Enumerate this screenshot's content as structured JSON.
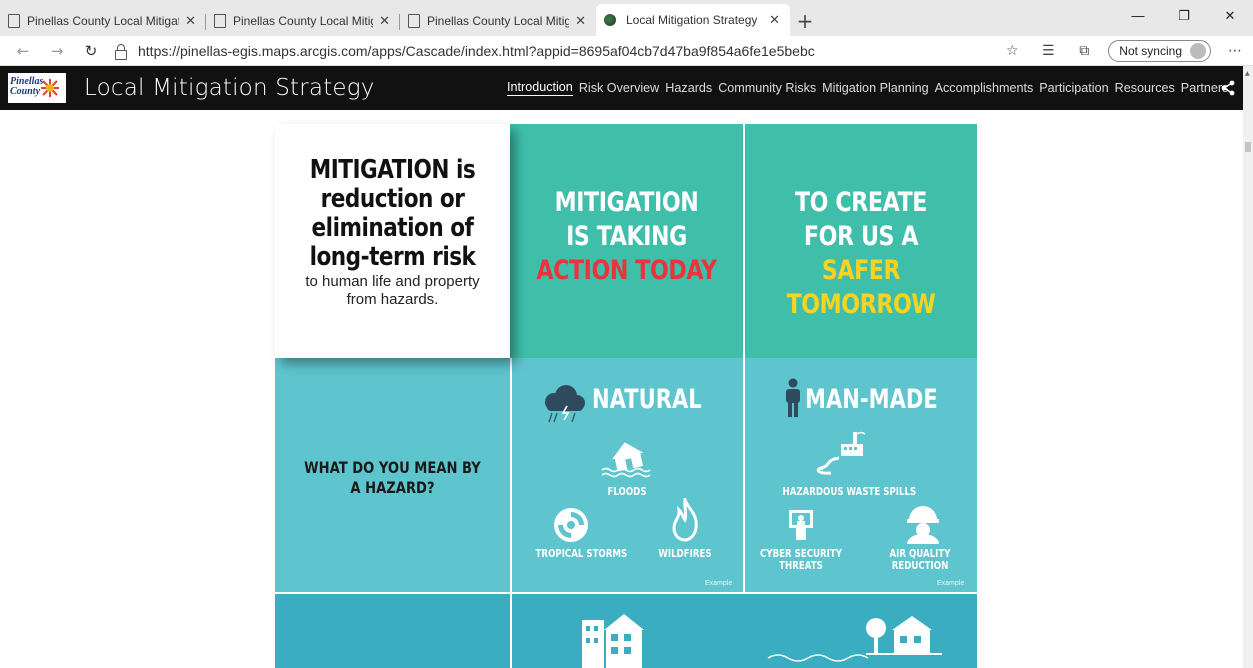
{
  "browser": {
    "tabs": [
      {
        "label": "Pinellas County Local Mitigation"
      },
      {
        "label": "Pinellas County Local Mitigation"
      },
      {
        "label": "Pinellas County Local Mitigation"
      },
      {
        "label": "Local Mitigation Strategy",
        "active": true
      }
    ],
    "url": "https://pinellas-egis.maps.arcgis.com/apps/Cascade/index.html?appid=8695af04cb7d47ba9f854a6fe1e5bebc",
    "sync_label": "Not syncing"
  },
  "app": {
    "logo_text_line1": "Pinellas",
    "logo_text_line2": "County",
    "title": "Local Mitigation Strategy",
    "nav": [
      "Introduction",
      "Risk Overview",
      "Hazards",
      "Community Risks",
      "Mitigation Planning",
      "Accomplishments",
      "Participation",
      "Resources",
      "Partners"
    ]
  },
  "infographic": {
    "definition": {
      "line1": "MITIGATION is",
      "line2": "reduction or",
      "line3": "elimination of",
      "line4": "long-term risk",
      "small1": "to human life and property",
      "small2": "from hazards."
    },
    "panel_action": {
      "line1": "MITIGATION",
      "line2": "IS TAKING",
      "line3": "ACTION TODAY"
    },
    "panel_safer": {
      "line1": "TO CREATE",
      "line2": "FOR US A",
      "line3": "SAFER TOMORROW"
    },
    "hazard_question": {
      "line1": "WHAT DO YOU MEAN BY",
      "line2": "A HAZARD?"
    },
    "natural": {
      "title": "NATURAL",
      "items": [
        "FLOODS",
        "TROPICAL STORMS",
        "WILDFIRES"
      ],
      "example": "Example"
    },
    "manmade": {
      "title": "MAN-MADE",
      "items": [
        "HAZARDOUS WASTE SPILLS",
        "CYBER SECURITY",
        "THREATS",
        "AIR QUALITY",
        "REDUCTION"
      ],
      "example": "Example"
    },
    "colors": {
      "teal_green": "#3fbfaa",
      "teal_light": "#5ec4cd",
      "teal_dark": "#3aaec0",
      "red": "#e8343a",
      "yellow": "#f7d322"
    }
  }
}
